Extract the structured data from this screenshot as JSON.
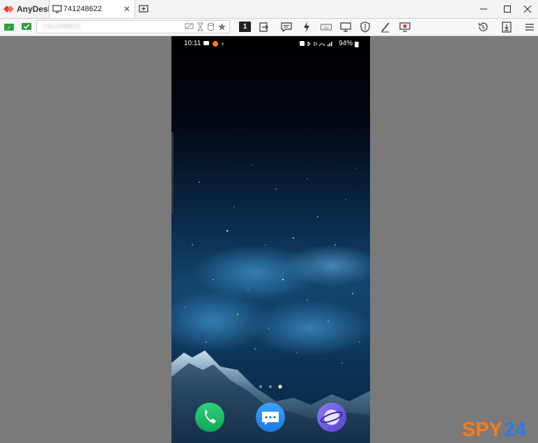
{
  "app": {
    "name": "AnyDesk",
    "brand_color": "#e53935"
  },
  "tab": {
    "label": "741248622",
    "close_icon": "close-icon"
  },
  "window": {
    "controls": [
      "minimize-icon",
      "maximize-icon",
      "close-icon"
    ]
  },
  "toolbar": {
    "address_value": "741248622",
    "monitor_number": "1",
    "icons_left": [
      "accept-icon",
      "chat-toggle-icon"
    ],
    "address_icons": [
      "display-icon",
      "hourglass-icon",
      "database-icon",
      "star-icon"
    ],
    "icons_mid": [
      "switch-side-icon",
      "chat-icon",
      "action-icon",
      "keyboard-icon",
      "display-settings-icon",
      "permissions-icon",
      "whiteboard-icon",
      "record-icon"
    ],
    "icons_right": [
      "history-icon",
      "file-transfer-icon",
      "menu-icon"
    ]
  },
  "phone": {
    "status_time": "10:11",
    "status_battery": "94%",
    "dock_apps": [
      "phone-app-icon",
      "messages-app-icon",
      "internet-app-icon"
    ],
    "page_dots": 3,
    "active_page": 3
  },
  "watermark": {
    "text_a": "SPY",
    "text_b": "24",
    "color_a": "#ff7a1a",
    "color_b": "#2c7be5"
  }
}
